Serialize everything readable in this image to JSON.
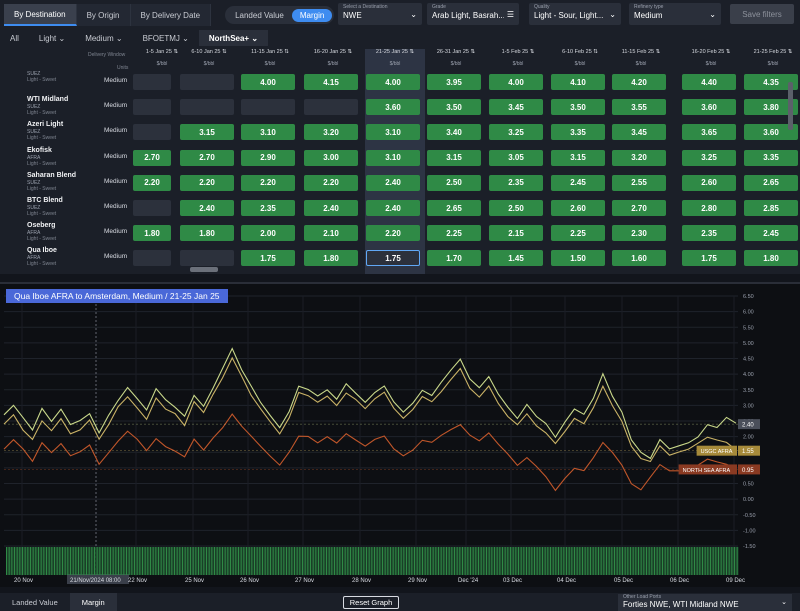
{
  "view_tabs": [
    "By Destination",
    "By Origin",
    "By Delivery Date"
  ],
  "toggle": {
    "a": "Landed Value",
    "b": "Margin"
  },
  "selects": [
    {
      "label": "Select a Destination",
      "value": "NWE"
    },
    {
      "label": "Grade",
      "value": "Arab Light, Basrah..."
    },
    {
      "label": "Quality",
      "value": "Light - Sour, Light..."
    },
    {
      "label": "Refinery type",
      "value": "Medium"
    }
  ],
  "save_label": "Save filters",
  "filters": [
    "All",
    "Light",
    "Medium",
    "BFOETMJ",
    "NorthSea+"
  ],
  "grid": {
    "delivery_window_label": "Delivery Window",
    "units_label": "Units",
    "columns": [
      "1-5 Jan 25",
      "6-10 Jan 25",
      "11-15 Jan 25",
      "16-20 Jan 25",
      "21-25 Jan 25",
      "26-31 Jan 25",
      "1-5 Feb 25",
      "6-10 Feb 25",
      "11-15 Feb 25",
      "16-20 Feb 25",
      "21-25 Feb 25"
    ],
    "unit": "$/bbl",
    "rows": [
      {
        "name": "",
        "origin": "SUEZ",
        "type": "Light - Sweet",
        "product": "Medium",
        "values": [
          "",
          "",
          "4.00",
          "4.15",
          "4.00",
          "3.95",
          "4.00",
          "4.10",
          "4.20",
          "4.40",
          "4.35"
        ]
      },
      {
        "name": "WTI Midland",
        "origin": "SUEZ",
        "type": "Light - Sweet",
        "product": "Medium",
        "values": [
          "",
          "",
          "",
          "",
          "3.60",
          "3.50",
          "3.45",
          "3.50",
          "3.55",
          "3.60",
          "3.80"
        ]
      },
      {
        "name": "Azeri Light",
        "origin": "SUEZ",
        "type": "Light - Sweet",
        "product": "Medium",
        "values": [
          "",
          "3.15",
          "3.10",
          "3.20",
          "3.10",
          "3.40",
          "3.25",
          "3.35",
          "3.45",
          "3.65",
          "3.60"
        ]
      },
      {
        "name": "Ekofisk",
        "origin": "AFRA",
        "type": "Light - Sweet",
        "product": "Medium",
        "values": [
          "2.70",
          "2.70",
          "2.90",
          "3.00",
          "3.10",
          "3.15",
          "3.05",
          "3.15",
          "3.20",
          "3.25",
          "3.35"
        ]
      },
      {
        "name": "Saharan Blend",
        "origin": "SUEZ",
        "type": "Light - Sweet",
        "product": "Medium",
        "values": [
          "2.20",
          "2.20",
          "2.20",
          "2.20",
          "2.40",
          "2.50",
          "2.35",
          "2.45",
          "2.55",
          "2.60",
          "2.65"
        ]
      },
      {
        "name": "BTC Blend",
        "origin": "SUEZ",
        "type": "Light - Sweet",
        "product": "Medium",
        "values": [
          "",
          "2.40",
          "2.35",
          "2.40",
          "2.40",
          "2.65",
          "2.50",
          "2.60",
          "2.70",
          "2.80",
          "2.85"
        ]
      },
      {
        "name": "Oseberg",
        "origin": "AFRA",
        "type": "Light - Sweet",
        "product": "Medium",
        "values": [
          "1.80",
          "1.80",
          "2.00",
          "2.10",
          "2.20",
          "2.25",
          "2.15",
          "2.25",
          "2.30",
          "2.35",
          "2.45"
        ]
      },
      {
        "name": "Qua Iboe",
        "origin": "AFRA",
        "type": "Light - Sweet",
        "product": "Medium",
        "values": [
          "",
          "",
          "1.75",
          "1.80",
          "1.75",
          "1.70",
          "1.45",
          "1.50",
          "1.60",
          "1.75",
          "1.80"
        ]
      }
    ]
  },
  "chart_title": "Qua Iboe AFRA to Amsterdam, Medium / 21-25 Jan 25",
  "chart_data": {
    "type": "line",
    "x_ticks": [
      "20 Nov",
      "21/Nov/2024 08:00",
      "22 Nov",
      "25 Nov",
      "26 Nov",
      "27 Nov",
      "28 Nov",
      "29 Nov",
      "Dec '24",
      "03 Dec",
      "04 Dec",
      "05 Dec",
      "06 Dec",
      "09 Dec"
    ],
    "ylim": [
      -1.5,
      6.5
    ],
    "y_ticks": [
      "6.50",
      "6.00",
      "5.50",
      "5.00",
      "4.50",
      "4.00",
      "3.50",
      "3.00",
      "2.50",
      "2.00",
      "1.50",
      "1.00",
      "0.50",
      "0.00",
      "-0.50",
      "-1.00",
      "-1.50"
    ],
    "series": [
      {
        "name": "",
        "color": "#c9d88a",
        "last_label": "2.40",
        "values": [
          2.7,
          2.9,
          2.5,
          2.2,
          3.0,
          2.6,
          2.9,
          2.3,
          2.4,
          2.7,
          2.2,
          2.8,
          3.2,
          3.5,
          3.1,
          2.8,
          3.6,
          3.3,
          3.0,
          2.6,
          3.2,
          2.9,
          3.6,
          4.3,
          4.9,
          4.1,
          3.5,
          3.0,
          2.7,
          2.4,
          2.9,
          3.6,
          3.4,
          3.2,
          3.5,
          3.3,
          3.8,
          3.4,
          3.0,
          3.3,
          3.6,
          3.2,
          2.9,
          3.1,
          3.4,
          3.2,
          3.7,
          4.2,
          4.6,
          3.9,
          3.5,
          3.8,
          3.3,
          3.0,
          2.7,
          3.1,
          2.6,
          2.3,
          1.9,
          2.5,
          3.0,
          2.8,
          3.2,
          3.9,
          3.2,
          2.8,
          2.0,
          1.6,
          1.3,
          1.8,
          1.5,
          1.7,
          1.9,
          2.1,
          2.4,
          2.2,
          2.5,
          2.4
        ]
      },
      {
        "name": "USGC AFRA",
        "color": "#c9b266",
        "last_label": "1.55",
        "values": [
          2.4,
          2.6,
          2.1,
          1.9,
          2.6,
          2.3,
          2.6,
          2.0,
          2.1,
          2.5,
          2.0,
          2.5,
          3.0,
          3.2,
          2.8,
          2.5,
          3.3,
          3.0,
          2.8,
          2.3,
          3.0,
          2.7,
          3.4,
          4.0,
          4.6,
          3.9,
          3.2,
          2.8,
          2.5,
          2.2,
          2.7,
          3.4,
          3.2,
          3.0,
          3.3,
          3.1,
          3.5,
          3.2,
          2.8,
          3.1,
          3.4,
          3.0,
          2.7,
          2.9,
          3.2,
          3.0,
          3.4,
          3.9,
          4.3,
          3.6,
          3.2,
          3.5,
          3.0,
          2.7,
          2.5,
          2.8,
          2.3,
          2.0,
          1.7,
          2.2,
          2.7,
          2.5,
          2.9,
          3.5,
          2.9,
          2.5,
          1.8,
          1.4,
          1.2,
          1.6,
          1.3,
          1.5,
          1.7,
          1.9,
          2.0,
          1.8,
          1.7,
          1.55
        ]
      },
      {
        "name": "NORTH SEA AFRA",
        "color": "#c0562a",
        "last_label": "0.95",
        "values": [
          1.6,
          1.8,
          1.5,
          1.2,
          1.9,
          1.6,
          1.8,
          1.3,
          1.4,
          1.7,
          1.2,
          1.6,
          1.9,
          2.1,
          1.8,
          1.5,
          2.0,
          1.8,
          1.6,
          1.3,
          1.8,
          1.5,
          2.0,
          2.4,
          2.8,
          2.3,
          1.9,
          1.6,
          1.4,
          1.2,
          1.6,
          2.0,
          1.9,
          1.7,
          2.0,
          1.9,
          2.2,
          1.9,
          1.6,
          1.8,
          2.0,
          1.7,
          1.5,
          1.6,
          1.8,
          1.7,
          2.0,
          2.3,
          2.5,
          2.1,
          1.8,
          2.0,
          1.7,
          1.5,
          1.2,
          1.4,
          1.0,
          0.6,
          0.2,
          0.7,
          1.1,
          1.0,
          1.3,
          1.7,
          1.4,
          1.1,
          0.6,
          0.4,
          0.7,
          1.0,
          0.8,
          0.9,
          1.1,
          1.2,
          1.3,
          1.1,
          1.0,
          0.95
        ]
      }
    ],
    "series_label_colors": [
      "#c9b266",
      "#a68a3a",
      "#8a3a22"
    ],
    "crosshair_x_label": "21/Nov/2024 08:00"
  },
  "bottom_tabs": [
    "Landed Value",
    "Margin"
  ],
  "reset_label": "Reset Graph",
  "other_ports": {
    "label": "Other Load Ports",
    "value": "Forties NWE, WTI Midland NWE"
  }
}
